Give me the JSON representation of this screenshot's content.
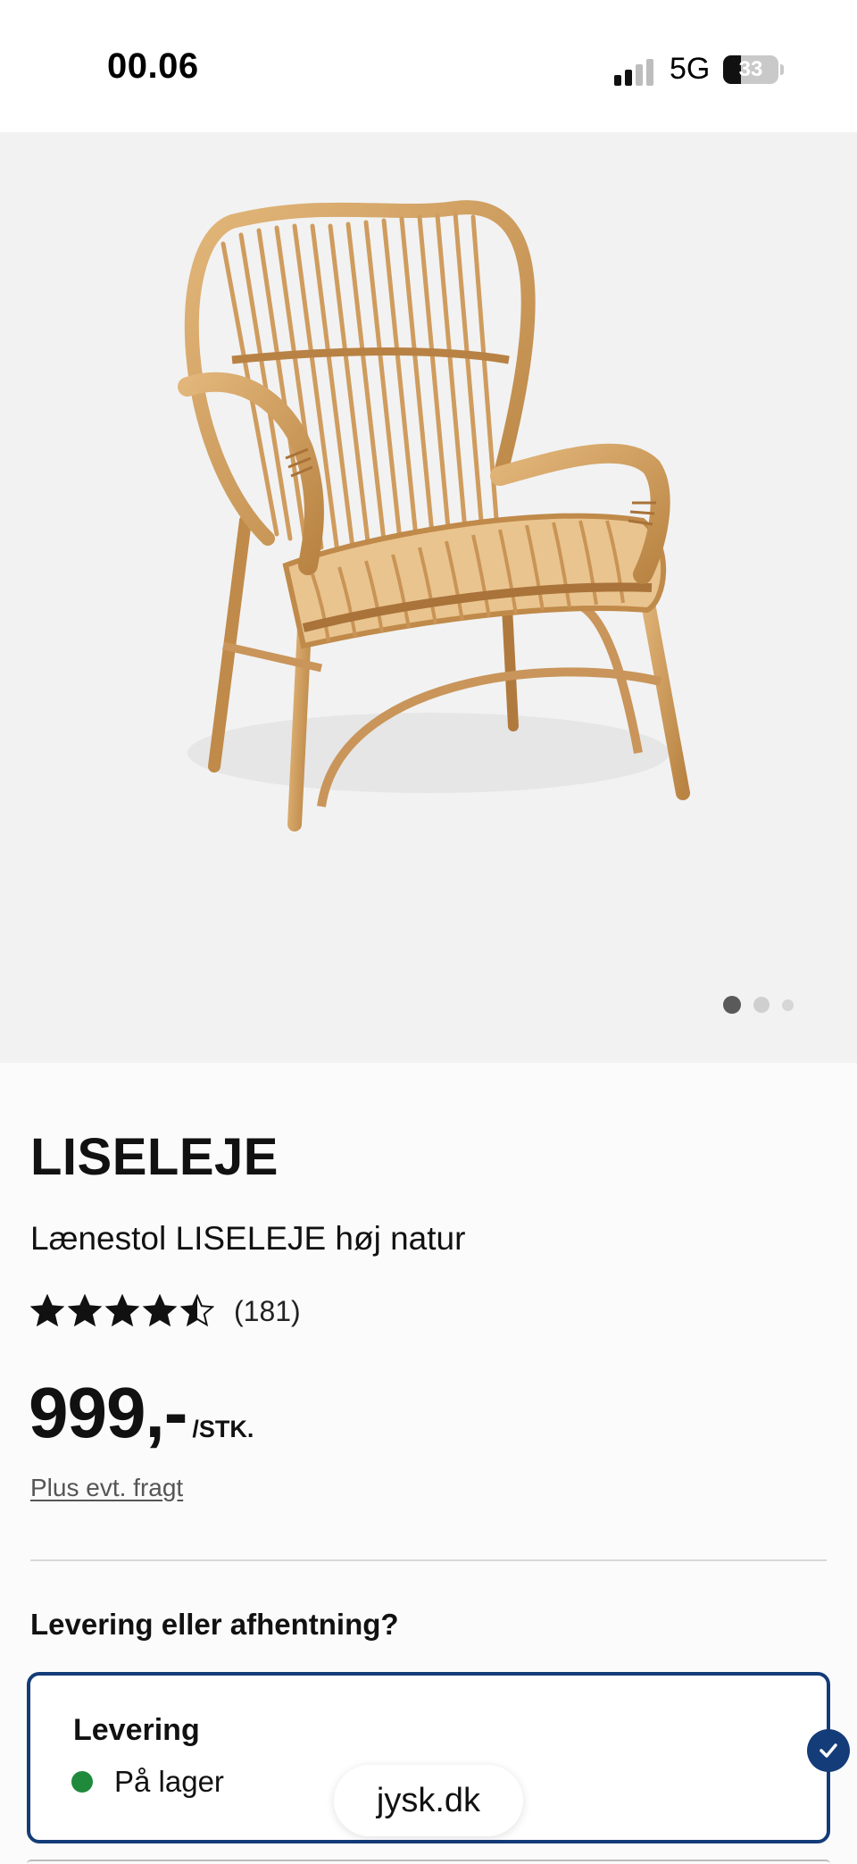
{
  "status_bar": {
    "time": "00.06",
    "network": "5G",
    "battery": "33",
    "battery_level": 0.33,
    "signal_bars_active": 2
  },
  "gallery": {
    "image_description_icon": "rattan-armchair-image",
    "dot_count": 3,
    "active_dot": 0
  },
  "product": {
    "title": "LISELEJE",
    "subtitle": "Lænestol LISELEJE høj natur",
    "rating": 4.5,
    "rating_max": 5,
    "review_count": "(181)",
    "price": "999,-",
    "price_unit": "/STK.",
    "shipping_note": "Plus evt. fragt"
  },
  "delivery": {
    "heading": "Levering eller afhentning?",
    "option": {
      "title": "Levering",
      "stock_status": "På lager",
      "selected": true
    }
  },
  "browser": {
    "url": "jysk.dk"
  },
  "colors": {
    "accent": "#143c78",
    "in_stock": "#1f8a3c",
    "gallery_bg": "#f2f2f2"
  }
}
